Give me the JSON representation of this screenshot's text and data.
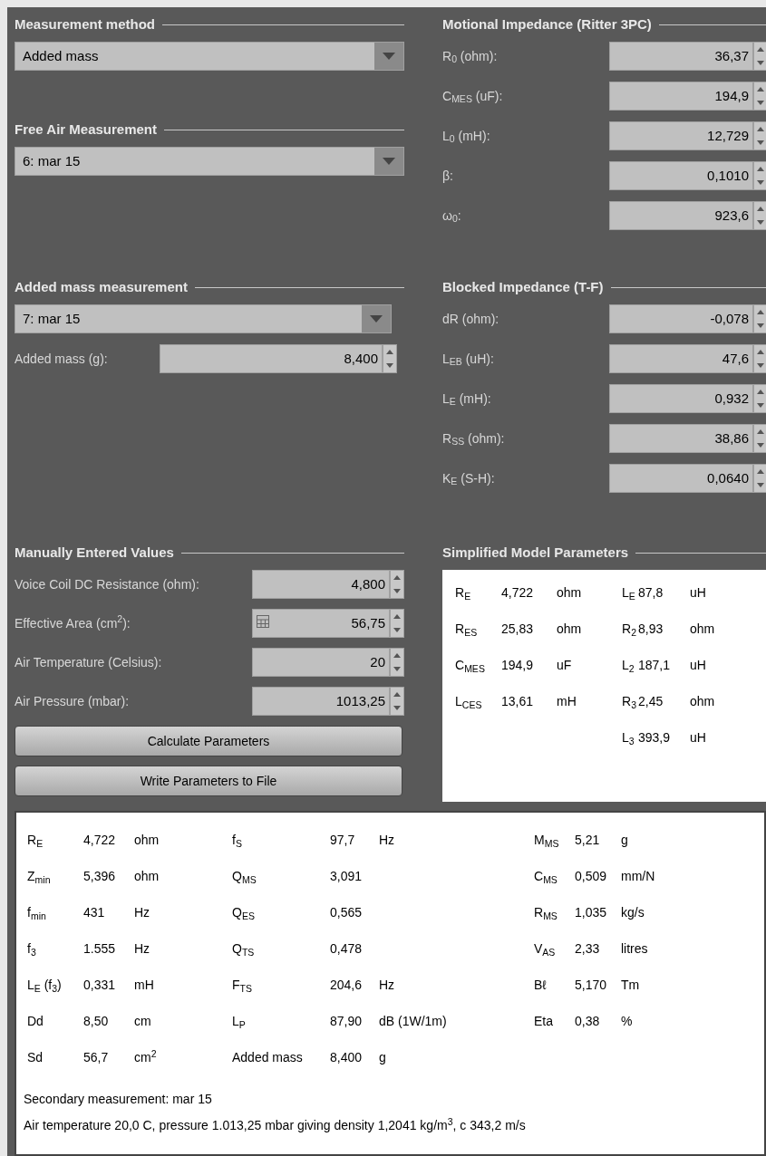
{
  "measurement_method": {
    "title": "Measurement method",
    "value": "Added mass"
  },
  "free_air": {
    "title": "Free Air Measurement",
    "value": "6: mar 15"
  },
  "added_mass_measurement": {
    "title": "Added mass measurement",
    "value": "7: mar 15",
    "field": {
      "label": "Added mass (g):",
      "value": "8,400"
    }
  },
  "motional_impedance": {
    "title": "Motional Impedance (Ritter 3PC)",
    "fields": [
      {
        "label": "R$_{0}$ (ohm):",
        "value": "36,37"
      },
      {
        "label": "C$_{MES}$ (uF):",
        "value": "194,9"
      },
      {
        "label": "L$_{0}$ (mH):",
        "value": "12,729"
      },
      {
        "label": "β:",
        "value": "0,1010"
      },
      {
        "label": "ω$_{0}$:",
        "value": "923,6"
      }
    ]
  },
  "blocked_impedance": {
    "title": "Blocked Impedance (T-F)",
    "fields": [
      {
        "label": "dR (ohm):",
        "value": "-0,078"
      },
      {
        "label": "L$_{EB}$ (uH):",
        "value": "47,6"
      },
      {
        "label": "L$_{E}$ (mH):",
        "value": "0,932"
      },
      {
        "label": "R$_{SS}$ (ohm):",
        "value": "38,86"
      },
      {
        "label": "K$_{E}$ (S-H):",
        "value": "0,0640"
      }
    ]
  },
  "manual_values": {
    "title": "Manually Entered Values",
    "fields": [
      {
        "label": "Voice Coil DC Resistance (ohm):",
        "value": "4,800",
        "calculator": false
      },
      {
        "label": "Effective Area (cm$^{2}$):",
        "value": "56,75",
        "calculator": true
      },
      {
        "label": "Air Temperature (Celsius):",
        "value": "20",
        "calculator": false
      },
      {
        "label": "Air Pressure (mbar):",
        "value": "1013,25",
        "calculator": false
      }
    ],
    "buttons": [
      "Calculate Parameters",
      "Write Parameters to File"
    ]
  },
  "simplified_model": {
    "title": "Simplified Model Parameters",
    "columns": [
      [
        {
          "symbol": "R$_{E}$",
          "value": "4,722",
          "unit": "ohm"
        },
        {
          "symbol": "R$_{ES}$",
          "value": "25,83",
          "unit": "ohm"
        },
        {
          "symbol": "C$_{MES}$",
          "value": "194,9",
          "unit": "uF"
        },
        {
          "symbol": "L$_{CES}$",
          "value": "13,61",
          "unit": "mH"
        }
      ],
      [
        {
          "symbol": "L$_{E}$",
          "value": "87,8",
          "unit": "uH"
        },
        {
          "symbol": "R$_{2}$",
          "value": "8,93",
          "unit": "ohm"
        },
        {
          "symbol": "L$_{2}$",
          "value": "187,1",
          "unit": "uH"
        },
        {
          "symbol": "R$_{3}$",
          "value": "2,45",
          "unit": "ohm"
        },
        {
          "symbol": "L$_{3}$",
          "value": "393,9",
          "unit": "uH"
        }
      ]
    ]
  },
  "results": {
    "columns": [
      [
        {
          "symbol": "R$_{E}$",
          "value": "4,722",
          "unit": "ohm"
        },
        {
          "symbol": "Z$_{min}$",
          "value": "5,396",
          "unit": "ohm"
        },
        {
          "symbol": "f$_{min}$",
          "value": "431",
          "unit": "Hz"
        },
        {
          "symbol": "f$_{3}$",
          "value": "1.555",
          "unit": "Hz"
        },
        {
          "symbol": "L$_{E}$ (f$_{3}$)",
          "value": "0,331",
          "unit": "mH"
        },
        {
          "symbol": "Dd",
          "value": "8,50",
          "unit": "cm"
        },
        {
          "symbol": "Sd",
          "value": "56,7",
          "unit": "cm$^{2}$"
        }
      ],
      [
        {
          "symbol": "f$_{S}$",
          "value": "97,7",
          "unit": "Hz"
        },
        {
          "symbol": "Q$_{MS}$",
          "value": "3,091"
        },
        {
          "symbol": "Q$_{ES}$",
          "value": "0,565"
        },
        {
          "symbol": "Q$_{TS}$",
          "value": "0,478"
        },
        {
          "symbol": "F$_{TS}$",
          "value": "204,6",
          "unit": "Hz"
        },
        {
          "symbol": "L$_{P}$",
          "value": "87,90",
          "unit": "dB (1W/1m)"
        },
        {
          "symbol": "Added mass",
          "value": "8,400",
          "unit": "g"
        }
      ],
      [
        {
          "symbol": "M$_{MS}$",
          "value": "5,21",
          "unit": "g"
        },
        {
          "symbol": "C$_{MS}$",
          "value": "0,509",
          "unit": "mm/N"
        },
        {
          "symbol": "R$_{MS}$",
          "value": "1,035",
          "unit": "kg/s"
        },
        {
          "symbol": "V$_{AS}$",
          "value": "2,33",
          "unit": "litres"
        },
        {
          "symbol": "Bℓ",
          "value": "5,170",
          "unit": "Tm"
        },
        {
          "symbol": "Eta",
          "value": "0,38",
          "unit": "%"
        }
      ]
    ],
    "notes": [
      "Secondary measurement: mar 15",
      "Air temperature 20,0 C, pressure 1.013,25 mbar giving density 1,2041 kg/m$^{3}$, c 343,2 m/s"
    ]
  }
}
